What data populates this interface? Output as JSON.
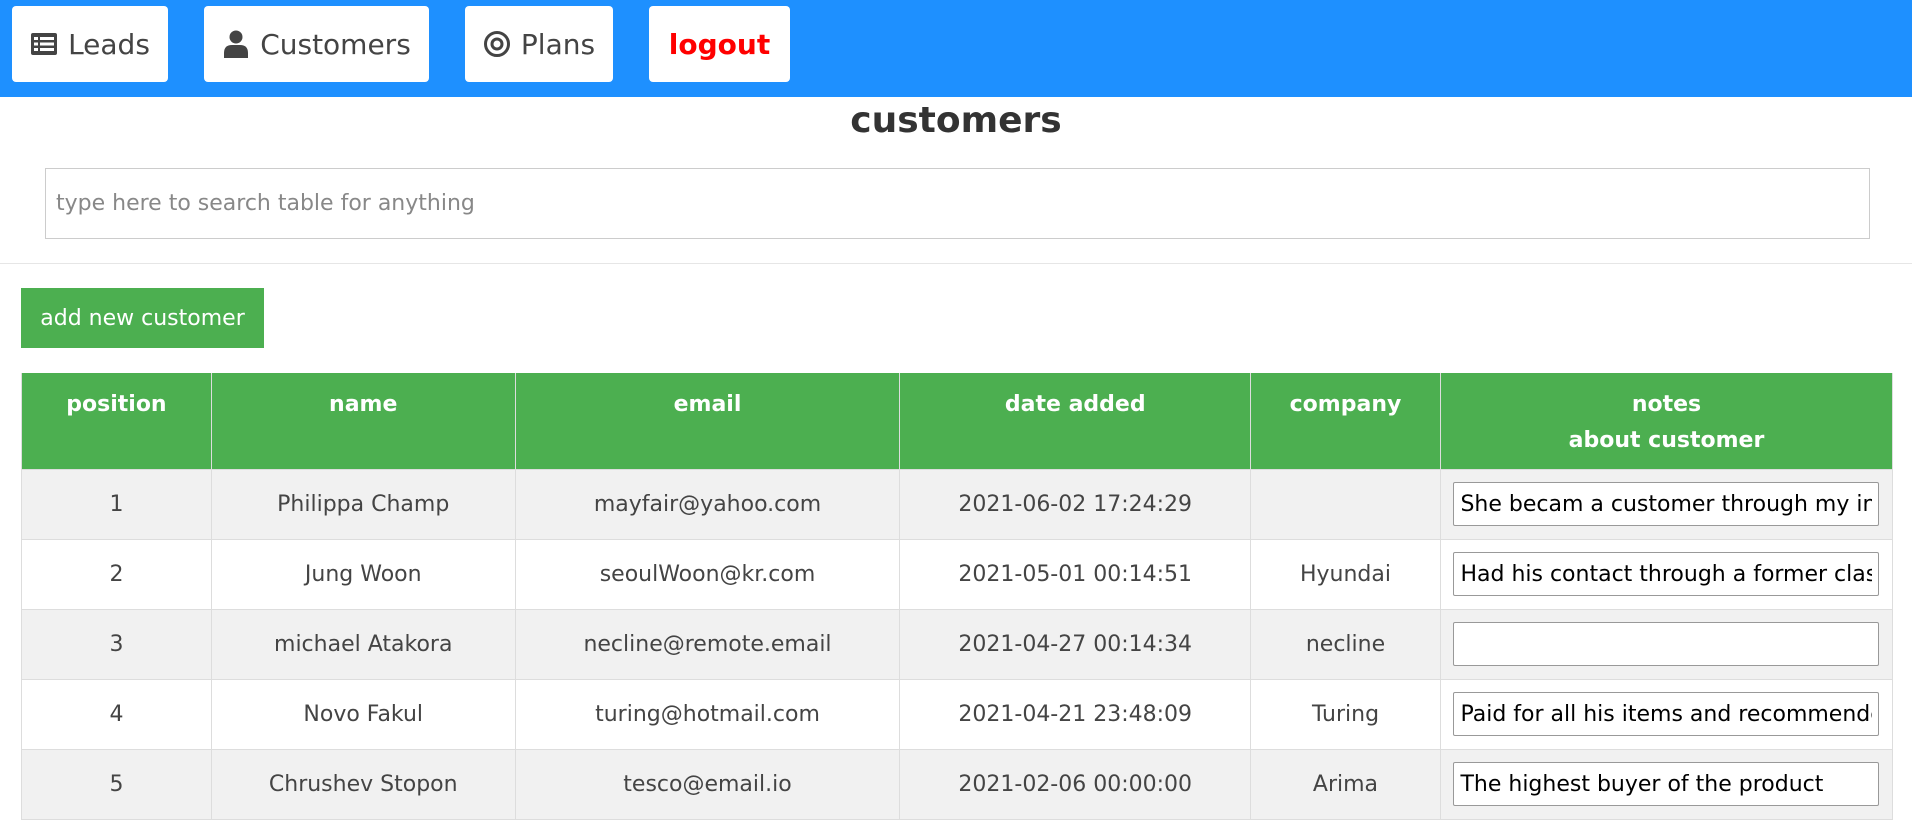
{
  "nav": {
    "leads_label": "Leads",
    "customers_label": "Customers",
    "plans_label": "Plans",
    "logout_label": "logout",
    "leads_icon": "list-icon",
    "customers_icon": "user-icon",
    "plans_icon": "target-icon"
  },
  "colors": {
    "topbar": "#1e90ff",
    "accent_green": "#4caf50",
    "logout_red": "#ff0000"
  },
  "page": {
    "title": "customers"
  },
  "search": {
    "placeholder": "type here to search table for anything",
    "value": ""
  },
  "actions": {
    "add_label": "add new customer"
  },
  "table": {
    "headers": {
      "position": "position",
      "name": "name",
      "email": "email",
      "date_added": "date added",
      "company": "company",
      "notes_line1": "notes",
      "notes_line2": "about customer"
    },
    "rows": [
      {
        "position": "1",
        "name": "Philippa Champ",
        "email": "mayfair@yahoo.com",
        "date_added": "2021-06-02 17:24:29",
        "company": "",
        "notes": "She becam a customer through my instagram page"
      },
      {
        "position": "2",
        "name": "Jung Woon",
        "email": "seoulWoon@kr.com",
        "date_added": "2021-05-01 00:14:51",
        "company": "Hyundai",
        "notes": "Had his contact through a former classmate"
      },
      {
        "position": "3",
        "name": "michael Atakora",
        "email": "necline@remote.email",
        "date_added": "2021-04-27 00:14:34",
        "company": "necline",
        "notes": ""
      },
      {
        "position": "4",
        "name": "Novo Fakul",
        "email": "turing@hotmail.com",
        "date_added": "2021-04-21 23:48:09",
        "company": "Turing",
        "notes": "Paid for all his items and recommended"
      },
      {
        "position": "5",
        "name": "Chrushev Stopon",
        "email": "tesco@email.io",
        "date_added": "2021-02-06 00:00:00",
        "company": "Arima",
        "notes": "The highest buyer of the product"
      }
    ]
  }
}
